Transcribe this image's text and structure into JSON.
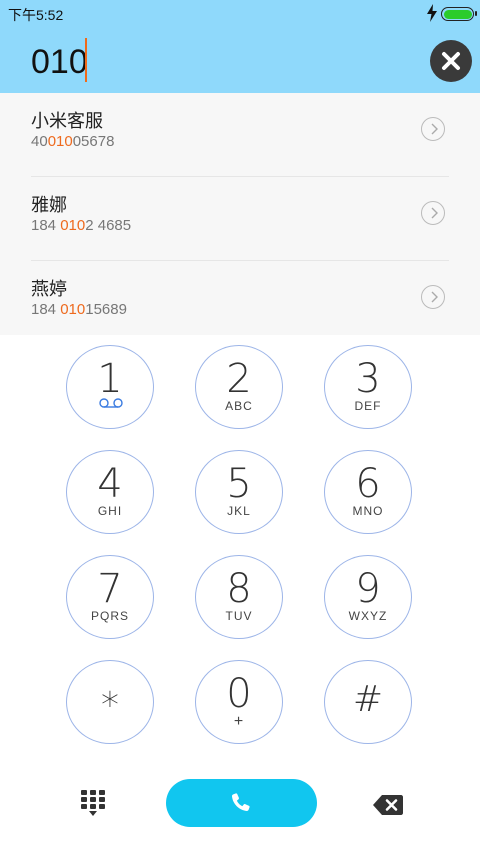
{
  "status_bar": {
    "time": "下午5:52",
    "battery_level": 1.0
  },
  "dial_input": {
    "value": "010"
  },
  "contacts": [
    {
      "name": "小米客服",
      "number_parts": [
        "40",
        "010",
        "05678"
      ]
    },
    {
      "name": "雅娜",
      "number_parts": [
        "184 ",
        "010",
        "2 4685"
      ]
    },
    {
      "name": "燕婷",
      "number_parts": [
        "184 ",
        "010",
        "15689"
      ]
    }
  ],
  "keypad": {
    "keys": [
      {
        "digit": "1",
        "letters": ""
      },
      {
        "digit": "2",
        "letters": "ABC"
      },
      {
        "digit": "3",
        "letters": "DEF"
      },
      {
        "digit": "4",
        "letters": "GHI"
      },
      {
        "digit": "5",
        "letters": "JKL"
      },
      {
        "digit": "6",
        "letters": "MNO"
      },
      {
        "digit": "7",
        "letters": "PQRS"
      },
      {
        "digit": "8",
        "letters": "TUV"
      },
      {
        "digit": "9",
        "letters": "WXYZ"
      },
      {
        "digit": "*",
        "letters": ""
      },
      {
        "digit": "0",
        "letters": "+"
      },
      {
        "digit": "#",
        "letters": ""
      }
    ]
  },
  "icons": {
    "clear": "close-icon",
    "voicemail": "voicemail-icon",
    "dialpad": "dialpad-icon",
    "call": "phone-icon",
    "backspace": "backspace-icon",
    "contact_detail": "chevron-right-icon"
  },
  "colors": {
    "header": "#8fd9fb",
    "highlight": "#ee6a1e",
    "call_button": "#11c6ef",
    "key_border": "#9db5e8"
  }
}
